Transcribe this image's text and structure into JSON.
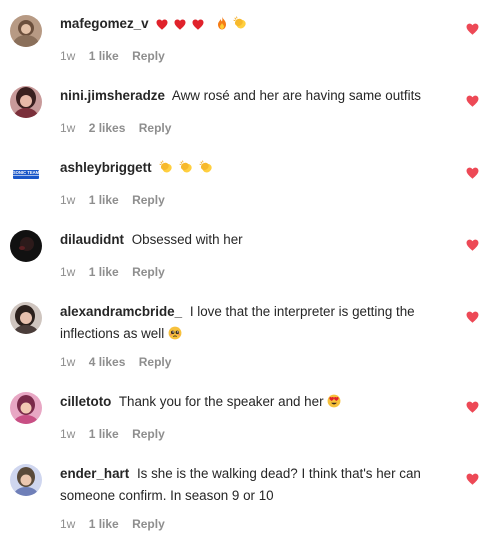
{
  "comments": [
    {
      "username": "mafegomez_v",
      "text": "",
      "emojis": [
        "red-heart",
        "red-heart",
        "red-heart",
        "fire",
        "clapping-hands"
      ],
      "time": "1w",
      "likes": "1 like",
      "reply": "Reply",
      "avatar_color": "#8a6f5a",
      "heart_color": "#ed4956"
    },
    {
      "username": "nini.jimsheradze",
      "text": "Aww rosé and her are having same outfits",
      "time": "1w",
      "likes": "2 likes",
      "reply": "Reply",
      "avatar_color": "#7a2f3a",
      "heart_color": "#ed4956"
    },
    {
      "username": "ashleybriggett",
      "text": "",
      "emojis": [
        "clapping-hands",
        "clapping-hands",
        "clapping-hands"
      ],
      "time": "1w",
      "likes": "1 like",
      "reply": "Reply",
      "avatar_label": "SONIC TEAM",
      "avatar_color": "#1a57c9",
      "heart_color": "#ed4956"
    },
    {
      "username": "dilaudidnt",
      "text": "Obsessed with her",
      "time": "1w",
      "likes": "1 like",
      "reply": "Reply",
      "avatar_color": "#1e1e1e",
      "heart_color": "#ed4956"
    },
    {
      "username": "alexandramcbride_",
      "text": "I love that the interpreter is getting the inflections as well",
      "emojis_after": [
        "pleading-face"
      ],
      "time": "1w",
      "likes": "4 likes",
      "reply": "Reply",
      "avatar_color": "#4a3d3a",
      "heart_color": "#ed4956"
    },
    {
      "username": "cilletoto",
      "text": "Thank you for the speaker and her",
      "emojis_after": [
        "heart-eyes"
      ],
      "time": "1w",
      "likes": "1 like",
      "reply": "Reply",
      "avatar_color": "#c84f84",
      "heart_color": "#ed4956"
    },
    {
      "username": "ender_hart",
      "text": "Is she is the walking dead? I think that's her can someone confirm. In season 9 or 10",
      "time": "1w",
      "likes": "1 like",
      "reply": "Reply",
      "avatar_color": "#6f7fb8",
      "heart_color": "#ed4956"
    }
  ]
}
